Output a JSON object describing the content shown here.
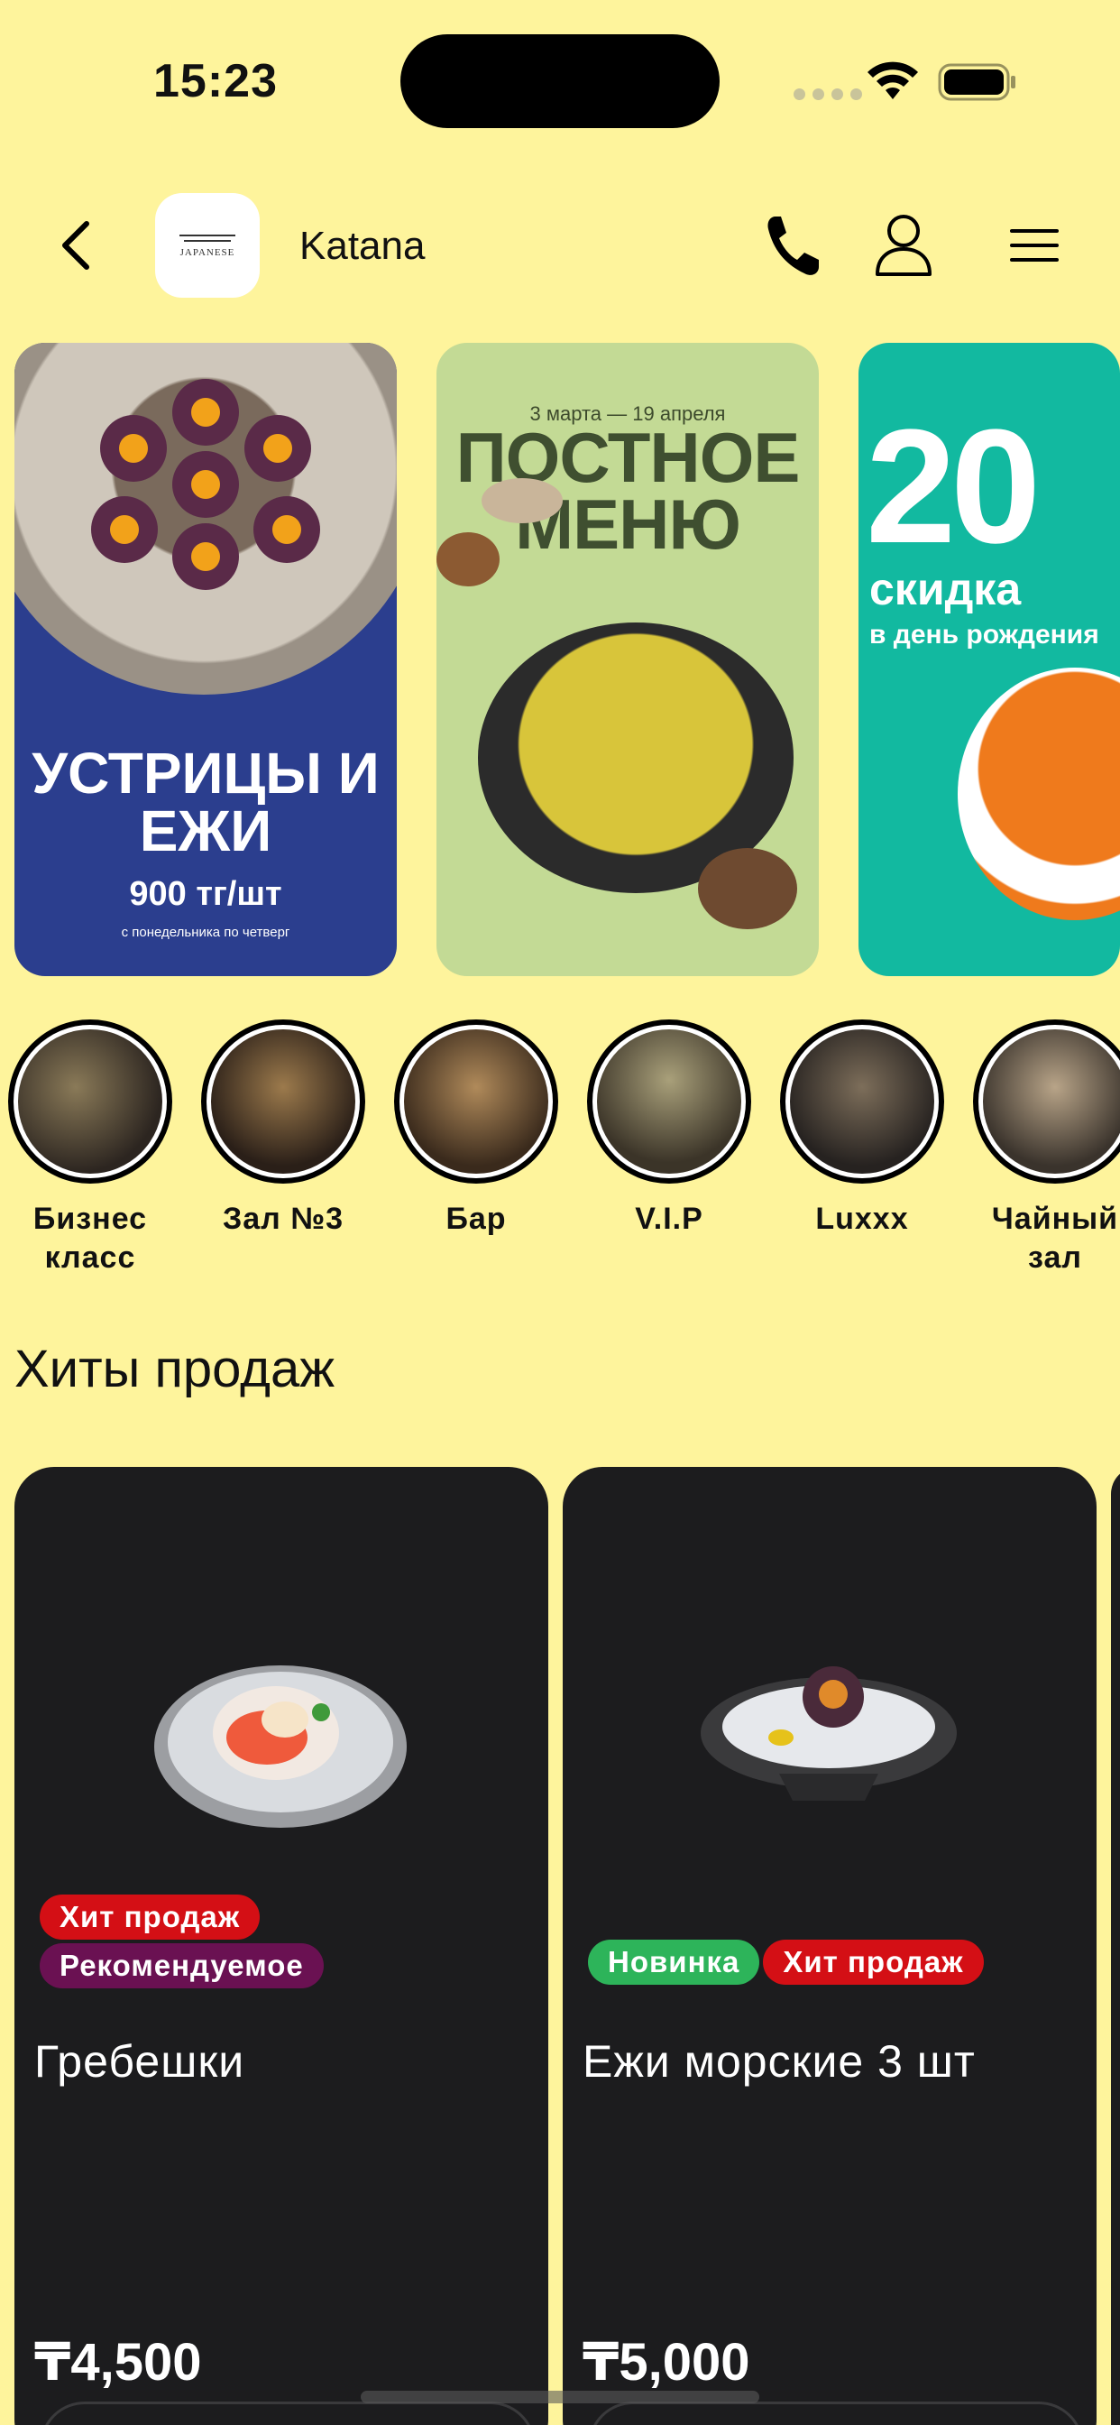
{
  "status_bar": {
    "time": "15:23"
  },
  "header": {
    "brand_name": "Katana",
    "logo_text": "JAPANESE"
  },
  "banners": [
    {
      "title": "УСТРИЦЫ И ЕЖИ",
      "price": "900 тг/шт",
      "subtitle": "с понедельника по четверг",
      "background": "#2B3E8E"
    },
    {
      "date": "3 марта — 19 апреля",
      "title": "ПОСТНОЕ МЕНЮ",
      "background": "#C3DA95"
    },
    {
      "big": "20",
      "title": "скидка",
      "subtitle": "в день рождения",
      "background": "#12B9A0"
    }
  ],
  "halls": [
    {
      "label": "Бизнес класс"
    },
    {
      "label": "Зал №3"
    },
    {
      "label": "Бар"
    },
    {
      "label": "V.I.P"
    },
    {
      "label": "Luxxx"
    },
    {
      "label": "Чайный зал"
    }
  ],
  "section": {
    "title": "Хиты продаж"
  },
  "products": [
    {
      "name": "Гребешки",
      "price": "₸4,500",
      "badges": [
        "Хит продаж",
        "Рекомендуемое"
      ]
    },
    {
      "name": "Ежи морские 3 шт",
      "price": "₸5,000",
      "badges": [
        "Новинка",
        "Хит продаж"
      ]
    }
  ],
  "colors": {
    "background": "#FEF49C",
    "card": "#1C1C1E",
    "badge_hit": "#D40F15",
    "badge_recommended": "#6A1152",
    "badge_new": "#2DB45A"
  }
}
